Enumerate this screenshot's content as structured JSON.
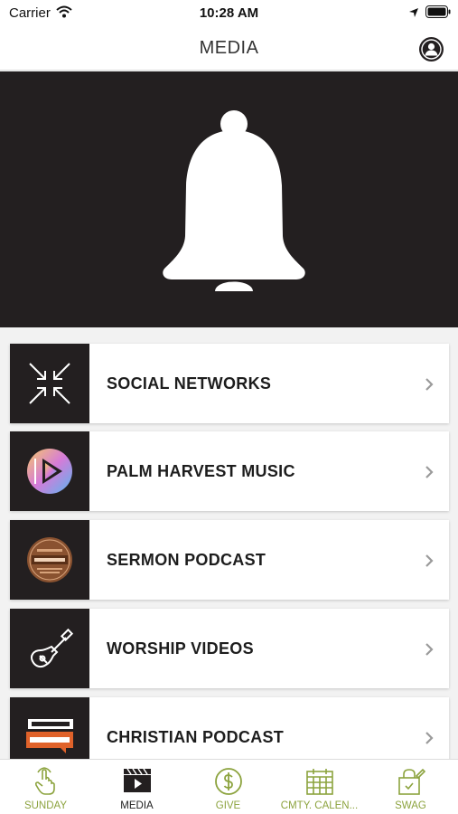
{
  "status_bar": {
    "carrier": "Carrier",
    "time": "10:28 AM"
  },
  "nav": {
    "title": "MEDIA",
    "profile_icon": "profile-icon"
  },
  "hero": {
    "icon": "bell-icon",
    "background": "#231f20"
  },
  "menu": {
    "items": [
      {
        "label": "SOCIAL NETWORKS",
        "icon": "social-arrows-icon"
      },
      {
        "label": "PALM HARVEST MUSIC",
        "icon": "play-music-logo"
      },
      {
        "label": "SERMON PODCAST",
        "icon": "harvest-podcast-logo"
      },
      {
        "label": "WORSHIP VIDEOS",
        "icon": "guitar-icon"
      },
      {
        "label": "CHRISTIAN PODCAST",
        "icon": "christian-podcast-logo"
      }
    ]
  },
  "tab_bar": {
    "accent_color": "#8ca33e",
    "tabs": [
      {
        "label": "SUNDAY",
        "icon": "tap-hand-icon"
      },
      {
        "label": "MEDIA",
        "icon": "clapperboard-icon",
        "active": true
      },
      {
        "label": "GIVE",
        "icon": "dollar-circle-icon"
      },
      {
        "label": "CMTY. CALEN...",
        "icon": "calendar-icon"
      },
      {
        "label": "SWAG",
        "icon": "bag-icon"
      }
    ]
  }
}
